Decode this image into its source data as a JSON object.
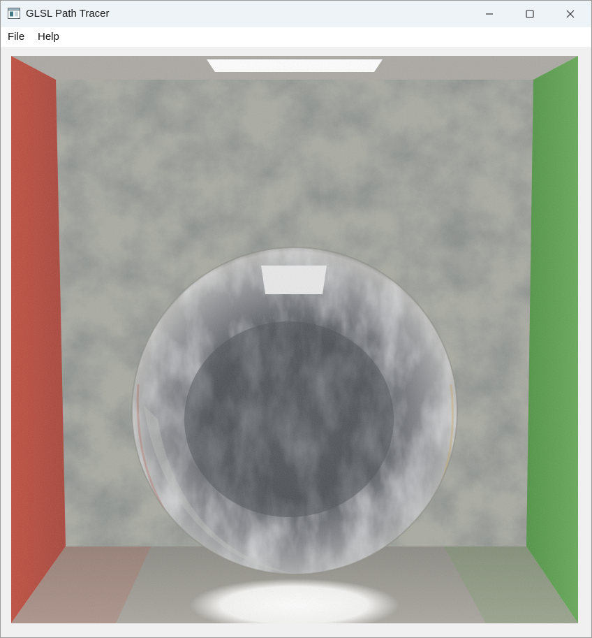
{
  "window": {
    "title": "GLSL Path Tracer",
    "app_icon": "app-window-icon",
    "controls": {
      "minimize_icon": "minimize-icon",
      "maximize_icon": "maximize-icon",
      "close_icon": "close-icon"
    }
  },
  "menu": {
    "items": [
      {
        "label": "File"
      },
      {
        "label": "Help"
      }
    ]
  },
  "render": {
    "scene": "cornell-box-glass-sphere",
    "colors": {
      "left_wall": "#b84a3c",
      "right_wall": "#5a9a48",
      "back_wall": "#a7aaa1",
      "ceiling": "#a9a6a2",
      "floor": "#9b9a92",
      "light": "#ffffff",
      "sphere_dark": "#4a4e54"
    }
  }
}
